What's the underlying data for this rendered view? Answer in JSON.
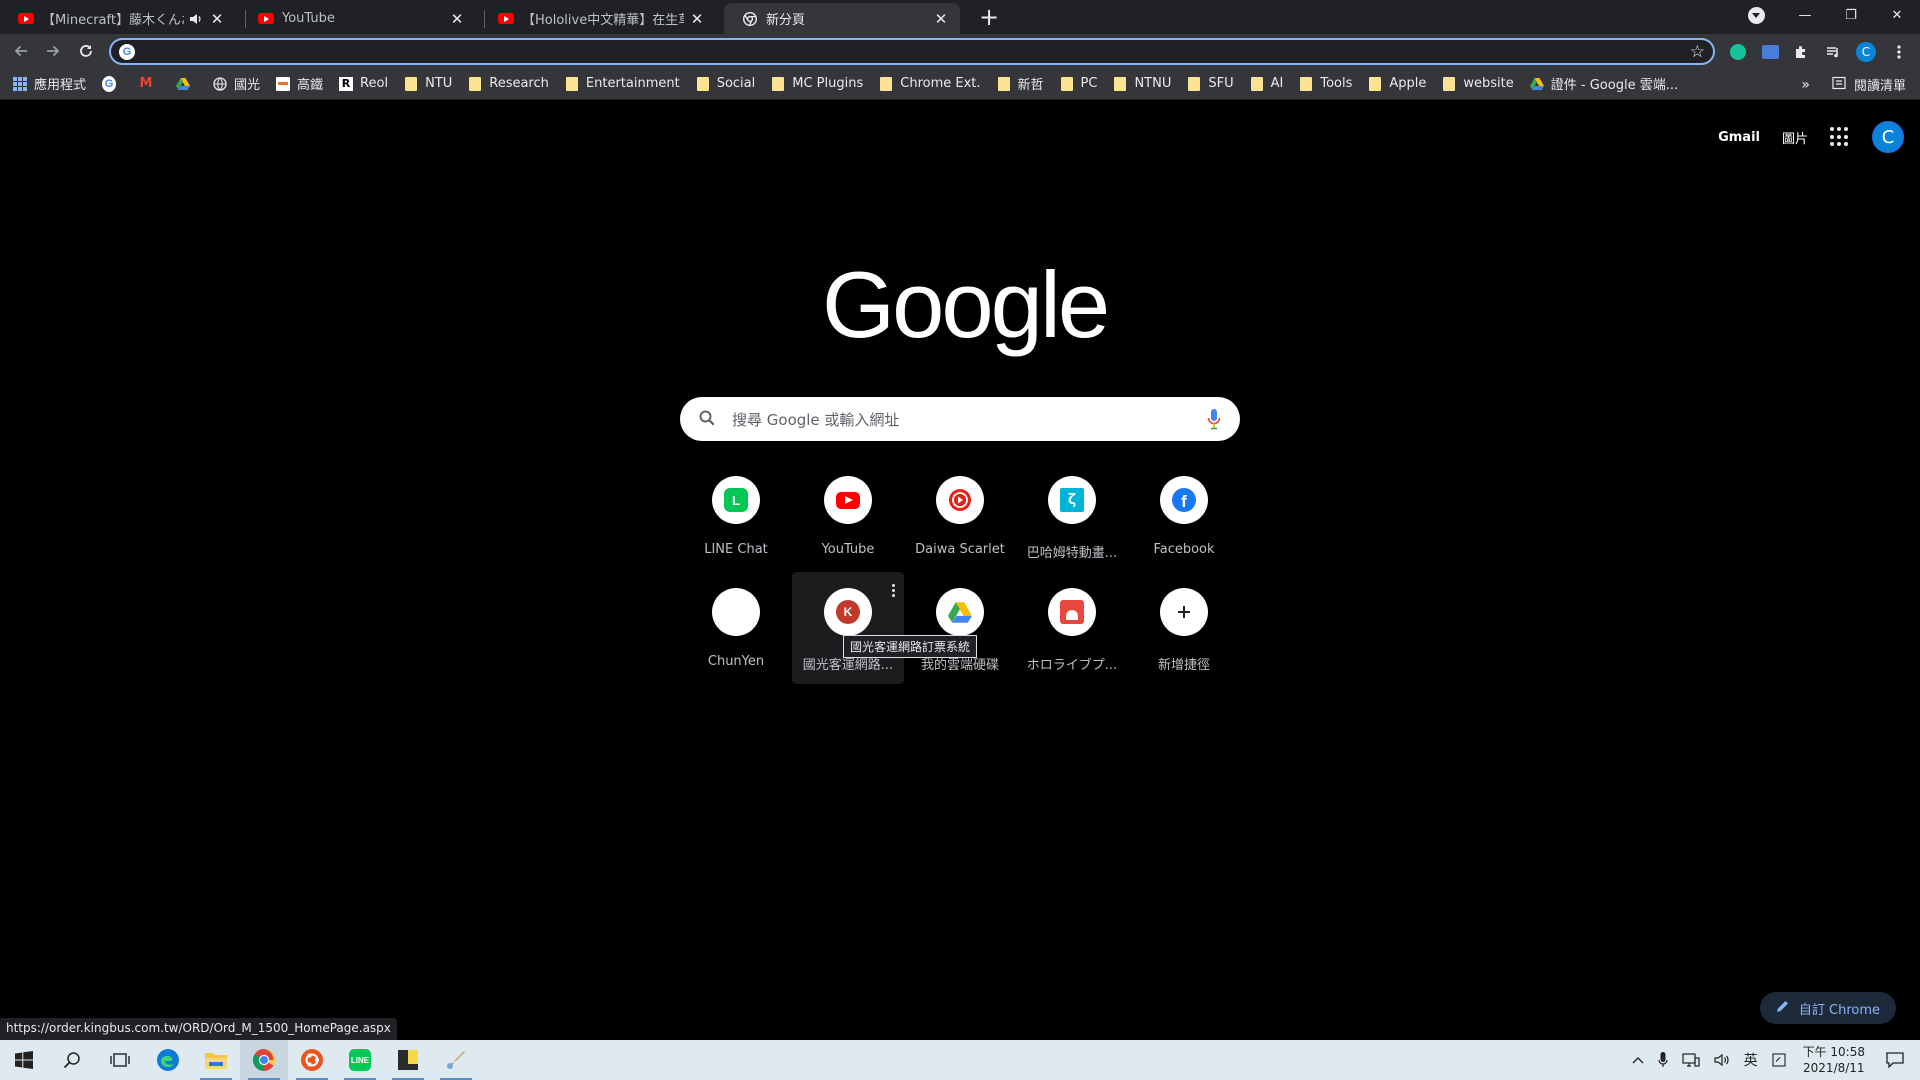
{
  "tabs": [
    {
      "title": "【Minecraft】藤木くんお迎",
      "icon": "youtube-icon",
      "audio": true
    },
    {
      "title": "YouTube",
      "icon": "youtube-icon",
      "audio": false
    },
    {
      "title": "【Hololive中文精華】在生草餌職",
      "icon": "youtube-icon",
      "audio": false
    },
    {
      "title": "新分頁",
      "icon": "chrome-icon",
      "audio": false,
      "active": true
    }
  ],
  "new_tab_symbol": "+",
  "window_controls": {
    "minimize": "—",
    "restore": "❐",
    "close": "✕"
  },
  "omnibox": {
    "value": "",
    "placeholder": ""
  },
  "profile_initial": "C",
  "bookmarks": [
    {
      "label": "應用程式",
      "icon": "apps-grid-icon"
    },
    {
      "label": "",
      "icon": "google-icon"
    },
    {
      "label": "",
      "icon": "gmail-icon"
    },
    {
      "label": "",
      "icon": "drive-icon"
    },
    {
      "label": "國光",
      "icon": "globe-icon"
    },
    {
      "label": "高鐵",
      "icon": "thsr-icon"
    },
    {
      "label": "Reol",
      "icon": "reol-icon"
    },
    {
      "label": "NTU",
      "icon": "folder-icon"
    },
    {
      "label": "Research",
      "icon": "folder-icon"
    },
    {
      "label": "Entertainment",
      "icon": "folder-icon"
    },
    {
      "label": "Social",
      "icon": "folder-icon"
    },
    {
      "label": "MC Plugins",
      "icon": "folder-icon"
    },
    {
      "label": "Chrome Ext.",
      "icon": "folder-icon"
    },
    {
      "label": "新哲",
      "icon": "folder-icon"
    },
    {
      "label": "PC",
      "icon": "folder-icon"
    },
    {
      "label": "NTNU",
      "icon": "folder-icon"
    },
    {
      "label": "SFU",
      "icon": "folder-icon"
    },
    {
      "label": "AI",
      "icon": "folder-icon"
    },
    {
      "label": "Tools",
      "icon": "folder-icon"
    },
    {
      "label": "Apple",
      "icon": "folder-icon"
    },
    {
      "label": "website",
      "icon": "folder-icon"
    },
    {
      "label": "證件 - Google 雲端...",
      "icon": "drive-icon"
    }
  ],
  "bookmarks_overflow": "»",
  "reading_list": "閱讀清單",
  "ntp": {
    "gmail": "Gmail",
    "images": "圖片",
    "avatar": "C",
    "logo": "Google",
    "search_placeholder": "搜尋 Google 或輸入網址",
    "shortcuts": [
      {
        "label": "LINE Chat",
        "icon": "line-icon"
      },
      {
        "label": "YouTube",
        "icon": "youtube-icon"
      },
      {
        "label": "Daiwa Scarlet",
        "icon": "daiwa-icon"
      },
      {
        "label": "巴哈姆特動畫...",
        "icon": "bahamut-icon"
      },
      {
        "label": "Facebook",
        "icon": "facebook-icon"
      },
      {
        "label": "ChunYen",
        "icon": "blank-icon"
      },
      {
        "label": "國光客運網路...",
        "icon": "kingbus-icon"
      },
      {
        "label": "我的雲端硬碟",
        "icon": "drive-icon"
      },
      {
        "label": "ホロライブプ...",
        "icon": "hololive-icon"
      },
      {
        "label": "新增捷徑",
        "icon": "plus-icon"
      }
    ],
    "tooltip": "國光客運網路訂票系統",
    "customize": "自訂 Chrome"
  },
  "status_url": "https://order.kingbus.com.tw/ORD/Ord_M_1500_HomePage.aspx",
  "taskbar": {
    "items": [
      "windows-start-icon",
      "search-icon",
      "task-view-icon",
      "edge-icon",
      "file-explorer-icon",
      "chrome-icon",
      "ubuntu-icon",
      "line-icon",
      "sticky-notes-icon",
      "paint-icon"
    ],
    "ime": "英",
    "time": "下午 10:58",
    "date": "2021/8/11"
  },
  "colors": {
    "accent": "#8ab4f8",
    "tab_strip": "#202124",
    "toolbar": "#35363a",
    "page_bg": "#000000"
  }
}
